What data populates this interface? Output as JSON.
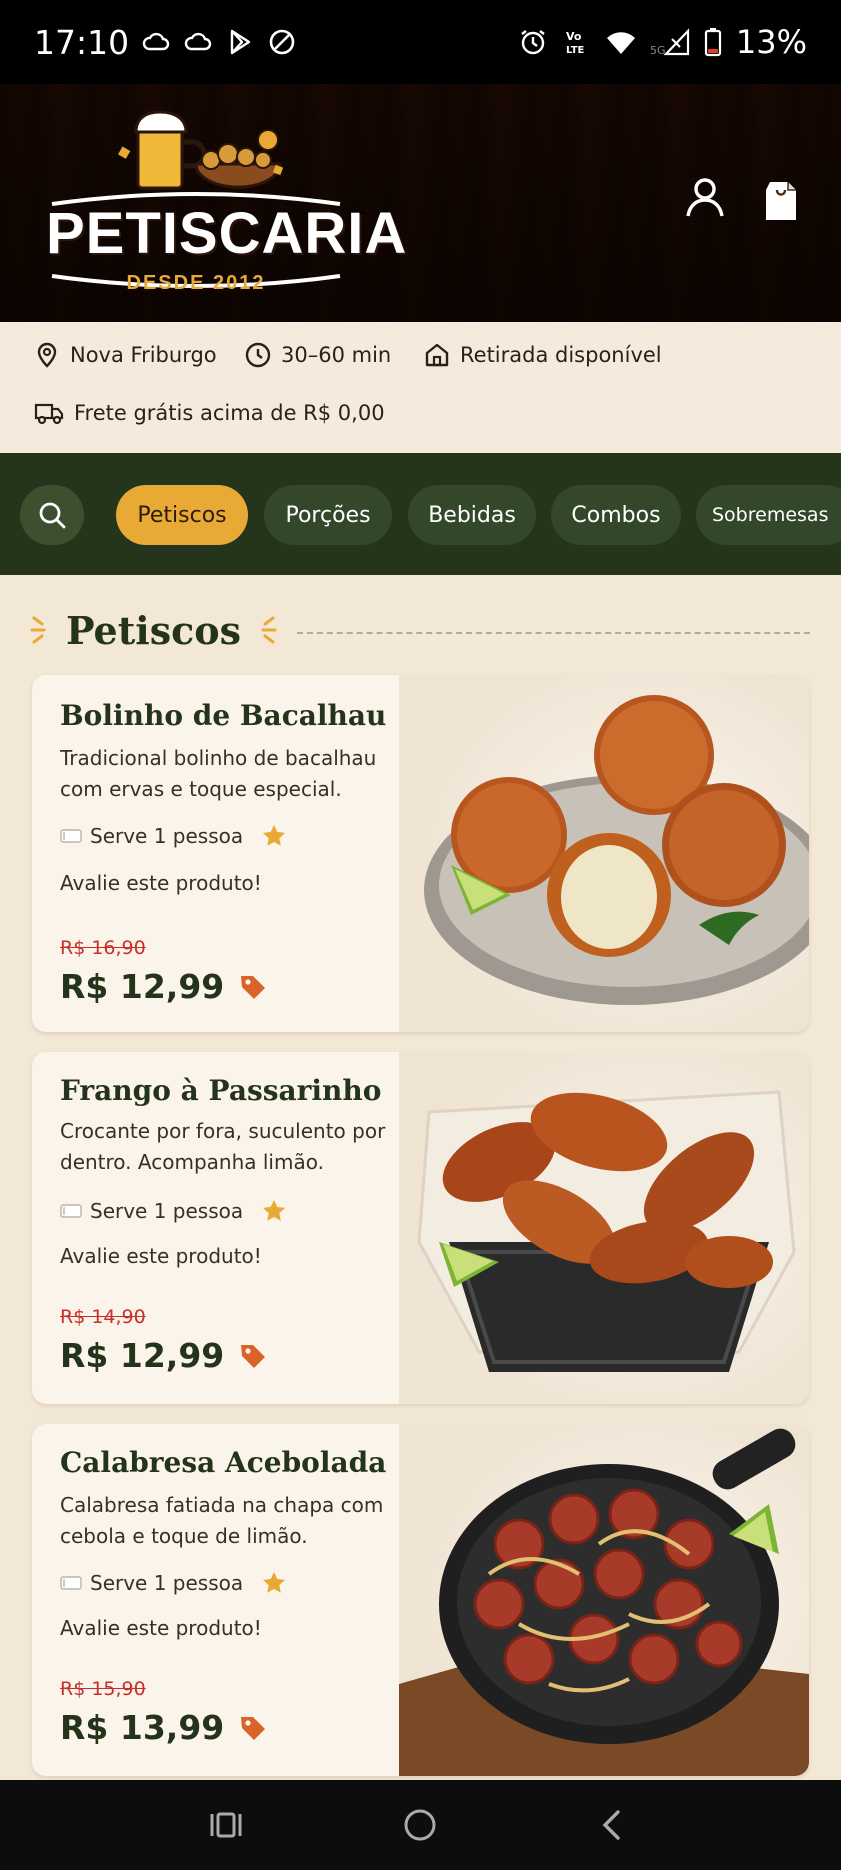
{
  "status_bar": {
    "time": "17:10",
    "left_icons": [
      "cloud-icon",
      "cloud-icon",
      "play-store-icon",
      "do-not-disturb-icon"
    ],
    "right_icons": [
      "alarm-icon",
      "volte-icon",
      "wifi-icon",
      "signal-5g-icon",
      "battery-icon"
    ],
    "battery": "13%"
  },
  "header": {
    "logo_title": "PETISCARIA",
    "logo_subtitle": "DESDE 2012",
    "user_icon": "user-icon",
    "bag_icon": "shopping-bag-icon"
  },
  "info": {
    "location": "Nova Friburgo",
    "time": "30–60 min",
    "pickup": "Retirada disponível",
    "shipping": "Frete grátis acima de R$ 0,00"
  },
  "categories": {
    "items": [
      "Petiscos",
      "Porções",
      "Bebidas",
      "Combos",
      "Sobremesas"
    ],
    "active": "Petiscos"
  },
  "section": {
    "title": "Petiscos"
  },
  "products": [
    {
      "name": "Bolinho de Bacalhau",
      "desc1": "Tradicional bolinho de bacalhau",
      "desc2": "com ervas e toque especial.",
      "serves": "Serve 1 pessoa",
      "rate": "Avalie este produto!",
      "old_price": "R$ 16,90",
      "price": "R$ 12,99"
    },
    {
      "name": "Frango à Passarinho",
      "desc1": "Crocante por fora, suculento por",
      "desc2": "dentro. Acompanha limão.",
      "serves": "Serve 1 pessoa",
      "rate": "Avalie este produto!",
      "old_price": "R$ 14,90",
      "price": "R$ 12,99"
    },
    {
      "name": "Calabresa Acebolada",
      "desc1": "Calabresa fatiada na chapa com",
      "desc2": "cebola e toque de limão.",
      "serves": "Serve 1 pessoa",
      "rate": "Avalie este produto!",
      "old_price": "R$ 15,90",
      "price": "R$ 13,99"
    }
  ],
  "colors": {
    "header_wood": "#4a2c17",
    "category_bar": "#24351c",
    "active_chip": "#e8a935",
    "price_green": "#23341b",
    "old_price_red": "#c7302a",
    "tag_orange": "#d9642a"
  }
}
